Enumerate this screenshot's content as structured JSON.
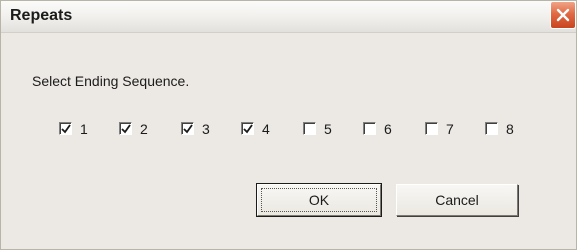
{
  "dialog": {
    "title": "Repeats",
    "prompt": "Select Ending Sequence.",
    "checkboxes": [
      {
        "label": "1",
        "checked": true
      },
      {
        "label": "2",
        "checked": true
      },
      {
        "label": "3",
        "checked": true
      },
      {
        "label": "4",
        "checked": true
      },
      {
        "label": "5",
        "checked": false
      },
      {
        "label": "6",
        "checked": false
      },
      {
        "label": "7",
        "checked": false
      },
      {
        "label": "8",
        "checked": false
      }
    ],
    "ok_label": "OK",
    "cancel_label": "Cancel",
    "close_icon": "close-icon",
    "colors": {
      "dialog_background": "#ece9e4",
      "close_button": "#e06a44"
    }
  }
}
